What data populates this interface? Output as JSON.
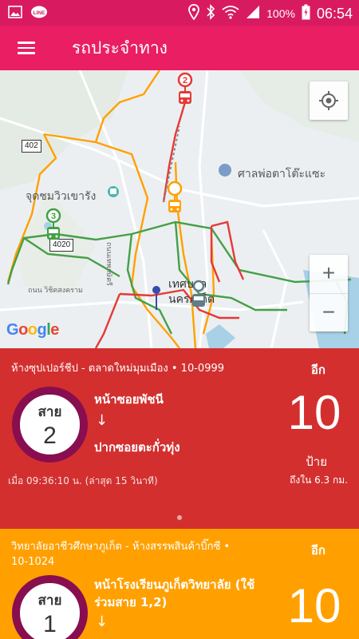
{
  "status_bar": {
    "battery": "100%",
    "time": "06:54",
    "icons": [
      "image-icon",
      "line-app-icon",
      "location-icon",
      "bluetooth-icon",
      "wifi-icon",
      "signal-icon",
      "battery-icon"
    ]
  },
  "app_bar": {
    "title": "รถประจำทาง",
    "menu_icon": "hamburger-menu-icon"
  },
  "map": {
    "labels": {
      "reservoir": "จุดชมวิวเขารัง",
      "shrine": "ศาลพ่อตาโต๊ะแซะ",
      "municipality_line1": "เทศบาล",
      "municipality_line2": "นครภูเก็ต",
      "road_vichit": "ถนน วิชิตสงคราม",
      "road_phang": "ถนนเทพกษัตรี"
    },
    "road_shields": [
      "402",
      "4020"
    ],
    "bus_markers": [
      {
        "route": "2",
        "color": "#e53935"
      },
      {
        "route": "3",
        "color": "#43a047"
      },
      {
        "route": "1",
        "color": "#ffa000"
      }
    ],
    "logo": "Google",
    "zoom_in": "+",
    "zoom_out": "−"
  },
  "cards": [
    {
      "route_text": "ห้างซุปเปอร์ชีป - ตลาดใหม่มุมเมือง  •  10-0999",
      "eek_label": "อีก",
      "line_label": "สาย",
      "line_number": "2",
      "from_stop": "หน้าซอยพัชนี",
      "arrow": "↓",
      "to_stop": "ปากซอยตะกั่วทุ่ง",
      "count": "10",
      "count_unit": "ป้าย",
      "distance": "ถึงใน 6.3 กม.",
      "updated": "เมื่อ 09:36:10 น. (ล่าสุด 15 วินาที)",
      "color": "#d32f2f"
    },
    {
      "route_text_line1": "วิทยาลัยอาชีวศึกษาภูเก็ต - ห้างสรรพสินค้าบิ๊กซี  •",
      "route_text_line2": "10-1024",
      "eek_label": "อีก",
      "line_label": "สาย",
      "line_number": "1",
      "from_stop_line1": "หน้าโรงเรียนภูเก็ตวิทยาลัย (ใช้",
      "from_stop_line2": "ร่วมสาย 1,2)",
      "arrow": "↓",
      "count": "10",
      "color": "#ffa000"
    }
  ]
}
